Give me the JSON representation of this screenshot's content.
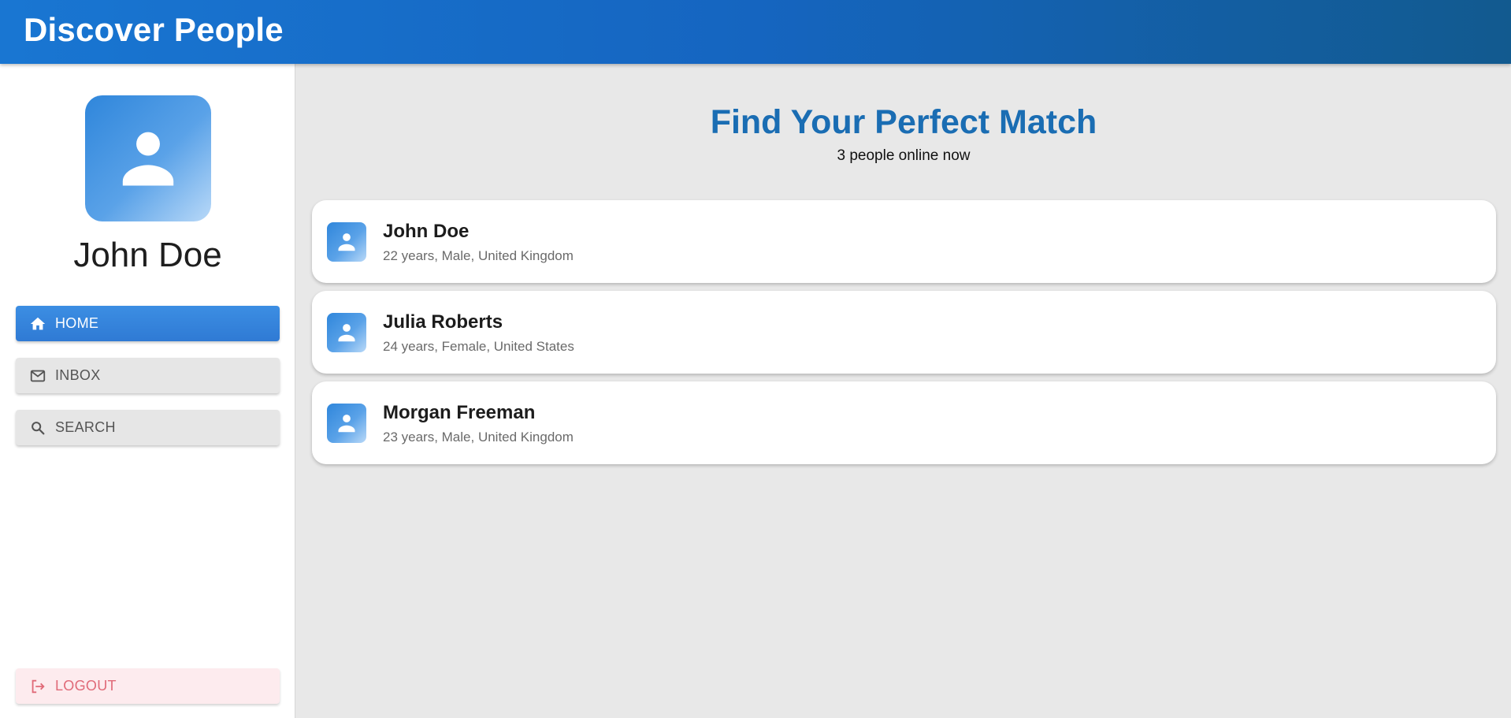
{
  "header": {
    "title": "Discover People"
  },
  "sidebar": {
    "profile_name": "John Doe",
    "nav": [
      {
        "label": "HOME",
        "icon": "home-icon",
        "active": true
      },
      {
        "label": "INBOX",
        "icon": "mail-icon",
        "active": false
      },
      {
        "label": "SEARCH",
        "icon": "search-icon",
        "active": false
      }
    ],
    "logout_label": "LOGOUT"
  },
  "main": {
    "title": "Find Your Perfect Match",
    "subtitle": "3 people online now",
    "people": [
      {
        "name": "John Doe",
        "details": "22 years, Male, United Kingdom"
      },
      {
        "name": "Julia Roberts",
        "details": "24 years, Female, United States"
      },
      {
        "name": "Morgan Freeman",
        "details": "23 years, Male, United Kingdom"
      }
    ]
  },
  "colors": {
    "accent": "#1976d2",
    "title": "#1a6db3",
    "logout": "#e06a78"
  }
}
